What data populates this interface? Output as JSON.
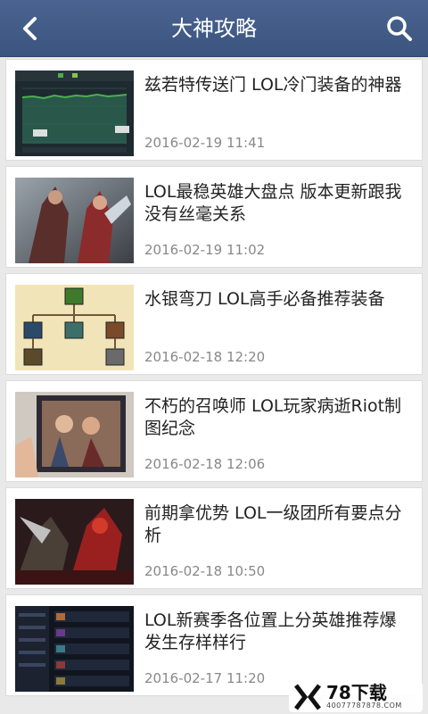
{
  "header": {
    "title": "大神攻略"
  },
  "articles": [
    {
      "title": "兹若特传送门 LOL冷门装备的神器",
      "date": "2016-02-19 11:41",
      "thumb": "stats-chart"
    },
    {
      "title": "LOL最稳英雄大盘点 版本更新跟我没有丝毫关系",
      "date": "2016-02-19 11:02",
      "thumb": "champion-art"
    },
    {
      "title": "水银弯刀 LOL高手必备推荐装备",
      "date": "2016-02-18 12:20",
      "thumb": "item-tree"
    },
    {
      "title": "不朽的召唤师 LOL玩家病逝Riot制图纪念",
      "date": "2016-02-18 12:06",
      "thumb": "poster-photo"
    },
    {
      "title": "前期拿优势 LOL一级团所有要点分析",
      "date": "2016-02-18 10:50",
      "thumb": "battle-art"
    },
    {
      "title": "LOL新赛季各位置上分英雄推荐爆发生存样样行",
      "date": "2016-02-17 11:20",
      "thumb": "tier-list"
    }
  ],
  "watermark": {
    "brand": "78下载",
    "url": "40077787878.COM"
  },
  "colors": {
    "header": "#3b5580",
    "card": "#ffffff",
    "date": "#888888"
  }
}
